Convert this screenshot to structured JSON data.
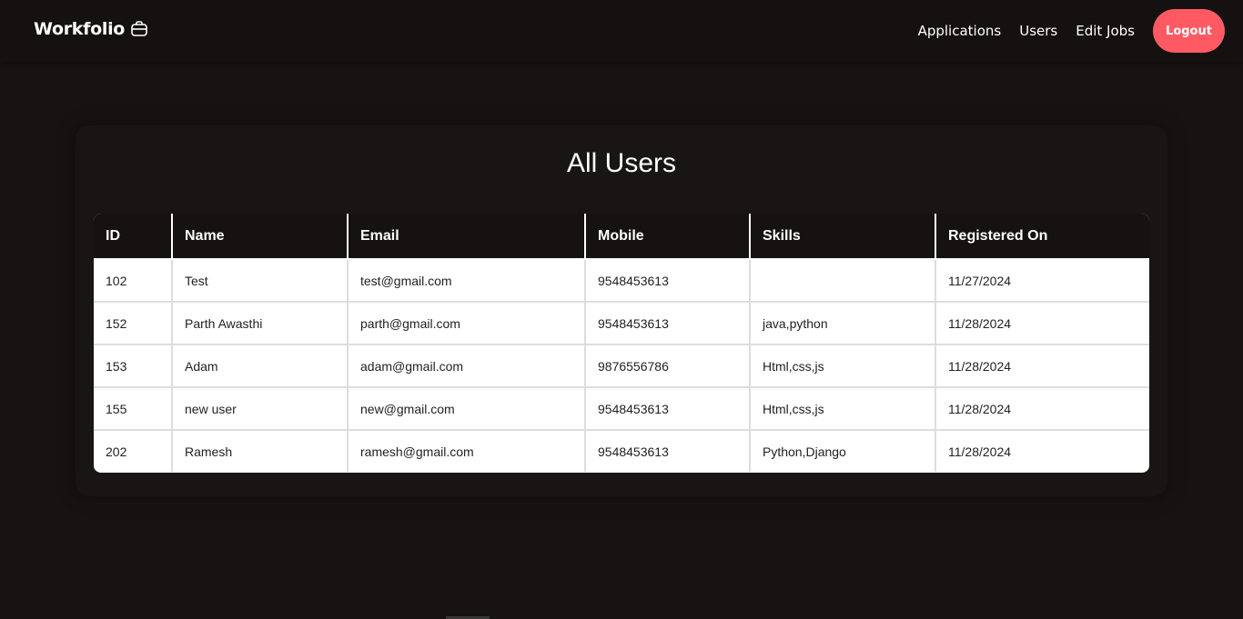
{
  "brand": {
    "name": "Workfolio",
    "icon": "briefcase-icon"
  },
  "nav": {
    "links": [
      "Applications",
      "Users",
      "Edit Jobs"
    ],
    "logout_label": "Logout"
  },
  "colors": {
    "accent": "#ff5a64",
    "background": "#161312",
    "header_row": "#161211"
  },
  "page": {
    "title": "All Users"
  },
  "table": {
    "columns": [
      "ID",
      "Name",
      "Email",
      "Mobile",
      "Skills",
      "Registered On"
    ],
    "rows": [
      [
        "102",
        "Test",
        "test@gmail.com",
        "9548453613",
        "",
        "11/27/2024"
      ],
      [
        "152",
        "Parth Awasthi",
        "parth@gmail.com",
        "9548453613",
        "java,python",
        "11/28/2024"
      ],
      [
        "153",
        "Adam",
        "adam@gmail.com",
        "9876556786",
        "Html,css,js",
        "11/28/2024"
      ],
      [
        "155",
        "new user",
        "new@gmail.com",
        "9548453613",
        "Html,css,js",
        "11/28/2024"
      ],
      [
        "202",
        "Ramesh",
        "ramesh@gmail.com",
        "9548453613",
        "Python,Django",
        "11/28/2024"
      ]
    ]
  }
}
